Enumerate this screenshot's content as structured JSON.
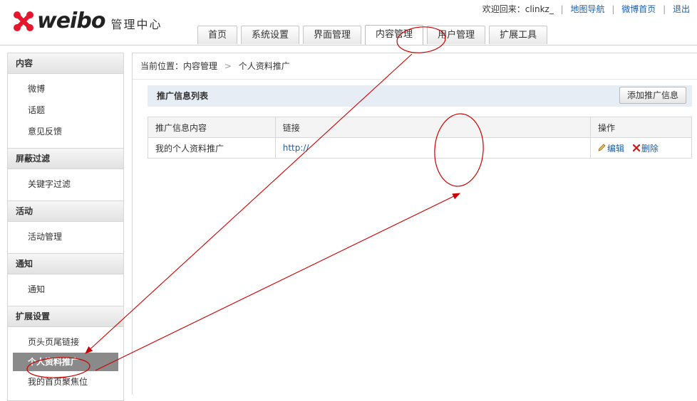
{
  "brand": {
    "logo_text": "weibo",
    "subtitle": "管理中心"
  },
  "toplinks": {
    "welcome": "欢迎回来：clinkz_",
    "sitemap": "地图导航",
    "home": "微博首页",
    "logout": "退出"
  },
  "tabs": [
    {
      "label": "首页"
    },
    {
      "label": "系统设置"
    },
    {
      "label": "界面管理"
    },
    {
      "label": "内容管理",
      "active": true
    },
    {
      "label": "用户管理"
    },
    {
      "label": "扩展工具"
    }
  ],
  "sidebar": {
    "groups": [
      {
        "title": "内容",
        "items": [
          "微博",
          "话题",
          "意见反馈"
        ]
      },
      {
        "title": "屏蔽过滤",
        "items": [
          "关键字过滤"
        ]
      },
      {
        "title": "活动",
        "items": [
          "活动管理"
        ]
      },
      {
        "title": "通知",
        "items": [
          "通知"
        ]
      },
      {
        "title": "扩展设置",
        "items": [
          "页头页尾链接",
          "个人资料推广",
          "我的首页聚焦位"
        ]
      }
    ],
    "active_item": "个人资料推广"
  },
  "breadcrumb": {
    "prefix": "当前位置：内容管理",
    "current": "个人资料推广"
  },
  "list": {
    "title": "推广信息列表",
    "add_button": "添加推广信息",
    "columns": [
      "推广信息内容",
      "链接",
      "操作"
    ],
    "rows": [
      {
        "content": "我的个人资料推广",
        "link": "http://",
        "edit": "编辑",
        "delete": "删除"
      }
    ]
  },
  "annotation_color": "#cc0000"
}
